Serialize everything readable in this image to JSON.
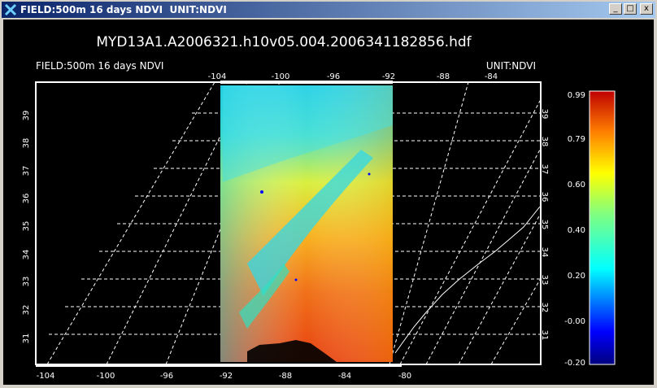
{
  "window": {
    "title": "FIELD:500m 16 days NDVI  UNIT:NDVI",
    "buttons": {
      "minimize": "_",
      "maximize": "□",
      "close": "x"
    }
  },
  "plot": {
    "filename": "MYD13A1.A2006321.h10v05.004.2006341182856.hdf",
    "field_label": "FIELD:500m 16 days NDVI",
    "unit_label": "UNIT:NDVI",
    "lon_top": [
      "-104",
      "-100",
      "-96",
      "-92",
      "-88",
      "-84"
    ],
    "lon_bottom": [
      "-104",
      "-100",
      "-96",
      "-92",
      "-88",
      "-84",
      "-80"
    ],
    "lat_labels": [
      "31",
      "32",
      "33",
      "34",
      "35",
      "36",
      "37",
      "38",
      "39"
    ]
  },
  "colorbar": {
    "ticks": [
      "0.99",
      "0.79",
      "0.60",
      "0.40",
      "0.20",
      "-0.00",
      "-0.20"
    ]
  },
  "colors": {
    "background": "#000000",
    "title_gradient_start": "#0a246a",
    "title_gradient_end": "#a6caf0"
  }
}
